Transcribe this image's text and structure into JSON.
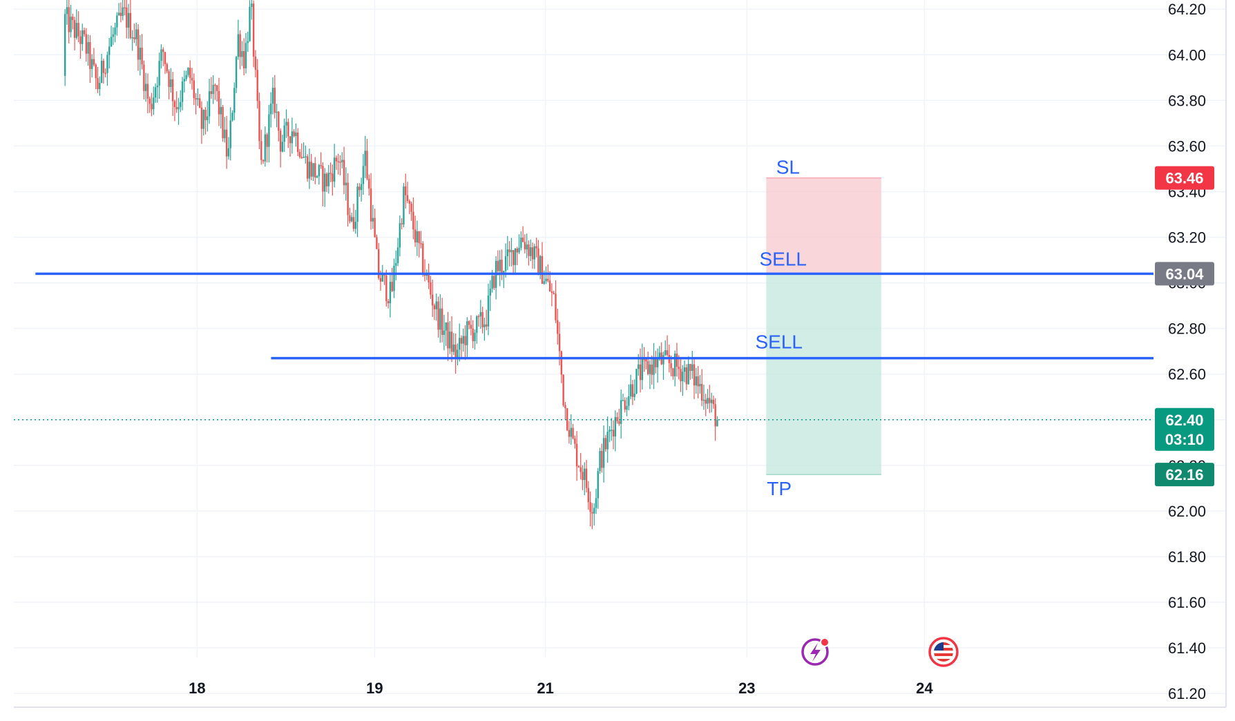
{
  "chart_data": {
    "type": "candlestick",
    "price_axis": {
      "ticks": [
        "64.20",
        "64.00",
        "63.80",
        "63.60",
        "63.40",
        "63.20",
        "63.00",
        "62.80",
        "62.60",
        "62.40",
        "62.20",
        "62.00",
        "61.80",
        "61.60",
        "61.40",
        "61.20"
      ],
      "ylim": [
        61.14,
        64.24
      ]
    },
    "time_axis": {
      "ticks": [
        {
          "label": "18",
          "pos": 0.161
        },
        {
          "label": "19",
          "pos": 0.317
        },
        {
          "label": "21",
          "pos": 0.467
        },
        {
          "label": "23",
          "pos": 0.644
        },
        {
          "label": "24",
          "pos": 0.8
        }
      ]
    },
    "grid": true,
    "series": [
      {
        "path": [
          [
            0.0,
            64.16
          ],
          [
            0.03,
            64.05
          ],
          [
            0.05,
            63.86
          ],
          [
            0.07,
            64.06
          ],
          [
            0.09,
            64.18
          ],
          [
            0.11,
            64.07
          ],
          [
            0.13,
            63.76
          ],
          [
            0.15,
            64.02
          ],
          [
            0.17,
            63.77
          ],
          [
            0.19,
            63.92
          ],
          [
            0.21,
            63.68
          ],
          [
            0.23,
            63.86
          ],
          [
            0.25,
            63.54
          ],
          [
            0.265,
            64.08
          ],
          [
            0.275,
            63.98
          ],
          [
            0.285,
            64.22
          ],
          [
            0.3,
            63.5
          ],
          [
            0.32,
            63.82
          ],
          [
            0.33,
            63.62
          ],
          [
            0.35,
            63.68
          ],
          [
            0.37,
            63.52
          ],
          [
            0.4,
            63.44
          ],
          [
            0.42,
            63.56
          ],
          [
            0.44,
            63.24
          ],
          [
            0.46,
            63.56
          ],
          [
            0.48,
            63.04
          ],
          [
            0.5,
            62.94
          ],
          [
            0.52,
            63.4
          ],
          [
            0.545,
            63.12
          ],
          [
            0.56,
            62.96
          ],
          [
            0.575,
            62.83
          ],
          [
            0.59,
            62.74
          ],
          [
            0.6,
            62.68
          ],
          [
            0.615,
            62.78
          ],
          [
            0.63,
            62.8
          ],
          [
            0.645,
            62.84
          ],
          [
            0.66,
            63.06
          ],
          [
            0.68,
            63.1
          ],
          [
            0.7,
            63.2
          ],
          [
            0.715,
            63.14
          ],
          [
            0.73,
            63.06
          ],
          [
            0.75,
            62.92
          ],
          [
            0.765,
            62.48
          ],
          [
            0.78,
            62.28
          ],
          [
            0.795,
            62.16
          ],
          [
            0.81,
            62.0
          ],
          [
            0.82,
            62.22
          ],
          [
            0.84,
            62.38
          ],
          [
            0.86,
            62.5
          ],
          [
            0.88,
            62.6
          ],
          [
            0.91,
            62.66
          ],
          [
            0.93,
            62.64
          ],
          [
            0.96,
            62.6
          ],
          [
            0.98,
            62.52
          ],
          [
            1.0,
            62.4
          ]
        ]
      }
    ],
    "horizontal_lines": [
      {
        "price": 63.04,
        "from": 0.019,
        "label": "SELL"
      },
      {
        "price": 62.67,
        "from": 0.226,
        "label": "SELL"
      }
    ],
    "position": {
      "stop_loss": 63.46,
      "entry": 63.04,
      "take_profit": 62.16,
      "from": 0.661,
      "to": 0.762
    },
    "labels": {
      "sl": "SL",
      "sell_upper": "SELL",
      "sell_lower": "SELL",
      "tp": "TP"
    },
    "price_badges": {
      "sl": "63.46",
      "entry": "63.04",
      "last": "62.40",
      "countdown": "03:10",
      "tp": "62.16"
    },
    "last_price": 62.4,
    "colors": {
      "up": "#26a69a",
      "down": "#ef5350",
      "line": "#2962ff",
      "sl_zone": "#f7c5cb",
      "tp_zone": "#bfe6dc",
      "sl_badge": "#f23645",
      "entry_badge": "#787b86",
      "last_badge": "#089981",
      "tp_badge": "#0f8a6e",
      "label_text": "#2962ff",
      "grid": "#f0f3fa",
      "axis_text": "#131722"
    },
    "icons": {
      "events": "lightning-event-icon",
      "economic": "us-flag-icon"
    }
  }
}
